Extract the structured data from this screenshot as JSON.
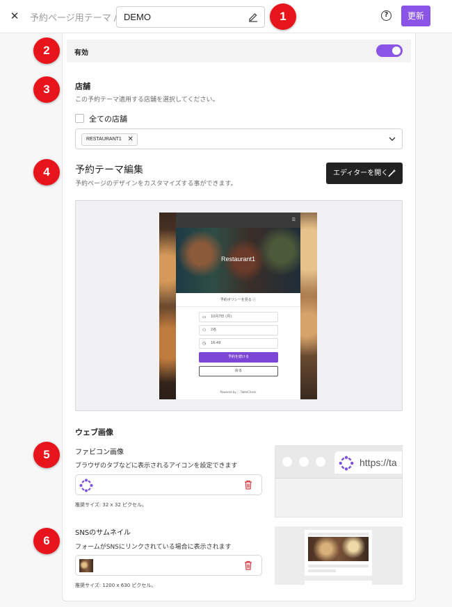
{
  "header": {
    "breadcrumb": "予約ページ用テーマ /",
    "theme_name": "DEMO",
    "update_label": "更新"
  },
  "badges": [
    "1",
    "2",
    "3",
    "4",
    "5",
    "6"
  ],
  "enabled": {
    "label": "有効",
    "on": true
  },
  "store": {
    "title": "店舗",
    "description": "この予約テーマ適用する店舗を選択してください。",
    "all_stores_label": "全ての店舗",
    "selected_chip": "RESTAURANT1"
  },
  "theme_edit": {
    "title": "予約テーマ編集",
    "description": "予約ページのデザインをカスタマイズする事ができます。",
    "editor_button": "エディターを開く"
  },
  "preview": {
    "restaurant_name": "Restaurant1",
    "policy_link": "予約ポリシーを見る ⓘ",
    "date_value": "10月7日 (月)",
    "party_value": "2名",
    "time_value": "16:49",
    "continue_label": "予約を続ける",
    "back_label": "戻る",
    "powered_by": "Powered by",
    "brand": "TableCheck"
  },
  "web_images": {
    "title": "ウェブ画像",
    "favicon": {
      "title": "ファビコン画像",
      "description": "ブラウザのタブなどに表示されるアイコンを設定できます",
      "hint": "推奨サイズ: 32 x 32 ピクセル。",
      "preview_url": "https://ta"
    },
    "sns": {
      "title": "SNSのサムネイル",
      "description": "フォームがSNSにリンクされている場合に表示されます",
      "hint": "推奨サイズ: 1200 x 630 ピクセル。"
    }
  },
  "colors": {
    "accent": "#8a55e6",
    "badge": "#e8141b",
    "dark_button": "#222222",
    "delete": "#d9363e"
  }
}
